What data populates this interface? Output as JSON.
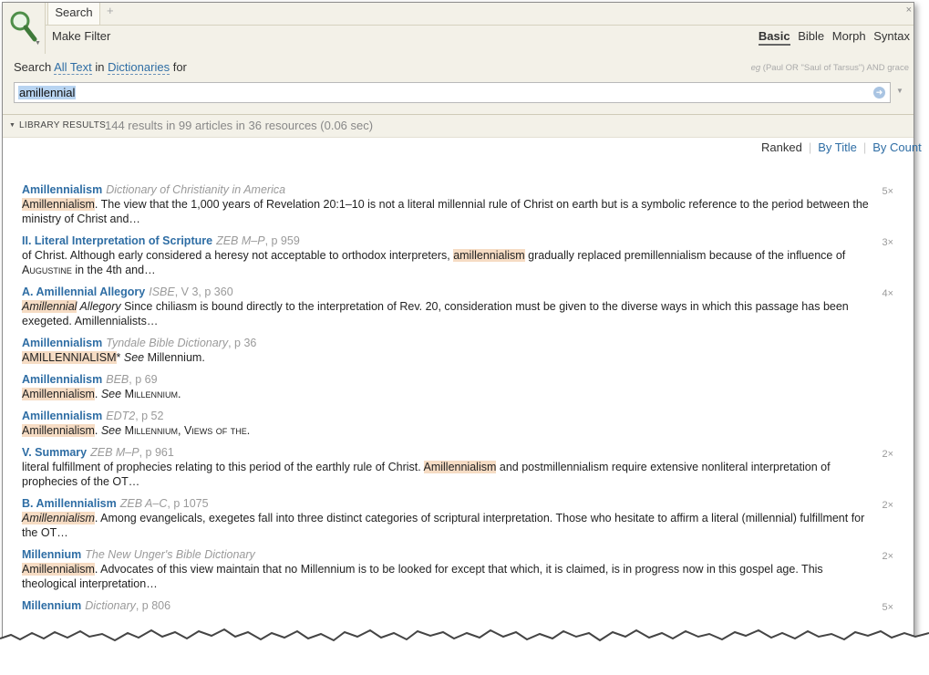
{
  "tabs": {
    "active": "Search",
    "add": "+",
    "close": "×"
  },
  "make_filter": "Make Filter",
  "modes": [
    "Basic",
    "Bible",
    "Morph",
    "Syntax"
  ],
  "search_line": {
    "prefix": "Search",
    "scope": "All Text",
    "in": "in",
    "collection": "Dictionaries",
    "for": "for"
  },
  "example": {
    "eg": "eg",
    "text": "(Paul OR \"Saul of Tarsus\") AND grace"
  },
  "query": "amillennial",
  "results_header": {
    "label": "LIBRARY RESULTS",
    "summary": "144 results in 99 articles in 36 resources (0.06 sec)"
  },
  "sort": {
    "ranked": "Ranked",
    "by_title": "By Title",
    "by_count": "By Count"
  },
  "results": [
    {
      "title": "Amillennialism",
      "source": "Dictionary of Christianity in America",
      "page": "",
      "count": "5×",
      "snippet": [
        [
          "Amillennialism",
          "hl"
        ],
        [
          ". The view that the 1,000 years of Revelation 20:1–10 is not a literal millennial rule of Christ on earth but is a symbolic reference to the period between the ministry of Christ and…",
          ""
        ]
      ]
    },
    {
      "title": "II. Literal Interpretation of Scripture",
      "source": "ZEB M–P",
      "page": ", p 959",
      "count": "3×",
      "snippet": [
        [
          "of Christ. Although early considered a heresy not acceptable to orthodox interpreters, ",
          ""
        ],
        [
          "amillennialism",
          "hl"
        ],
        [
          " gradually replaced premillennialism because of the influence of ",
          ""
        ],
        [
          "Augustine",
          "sc"
        ],
        [
          " in the 4th and…",
          ""
        ]
      ]
    },
    {
      "title": "A. Amillennial Allegory",
      "source": "ISBE",
      "page": ", V 3, p 360",
      "count": "4×",
      "snippet": [
        [
          "Amillennial",
          "hl-i"
        ],
        [
          " Allegory",
          "i"
        ],
        [
          " Since chiliasm is bound directly to the interpretation of Rev. 20, consideration must be given to the diverse ways in which this passage has been exegeted. Amillennialists…",
          ""
        ]
      ]
    },
    {
      "title": "Amillennialism",
      "source": "Tyndale Bible Dictionary",
      "page": ", p 36",
      "count": "",
      "snippet": [
        [
          "AMILLENNIALISM",
          "hl"
        ],
        [
          "* ",
          ""
        ],
        [
          "See",
          "i"
        ],
        [
          " Millennium.",
          ""
        ]
      ]
    },
    {
      "title": "Amillennialism",
      "source": "BEB",
      "page": ", p 69",
      "count": "",
      "snippet": [
        [
          "Amillennialism",
          "hl"
        ],
        [
          ". ",
          ""
        ],
        [
          "See",
          "i"
        ],
        [
          " ",
          ""
        ],
        [
          "Millennium.",
          "sc"
        ]
      ]
    },
    {
      "title": "Amillennialism",
      "source": "EDT2",
      "page": ", p 52",
      "count": "",
      "snippet": [
        [
          "Amillennialism",
          "hl"
        ],
        [
          ". ",
          ""
        ],
        [
          "See",
          "i"
        ],
        [
          " ",
          ""
        ],
        [
          "Millennium, Views of the.",
          "sc"
        ]
      ]
    },
    {
      "title": "V. Summary",
      "source": "ZEB M–P",
      "page": ", p 961",
      "count": "2×",
      "snippet": [
        [
          "literal fulfillment of prophecies relating to this period of the earthly rule of Christ. ",
          ""
        ],
        [
          "Amillennialism",
          "hl"
        ],
        [
          " and postmillennialism require extensive nonliteral interpretation of prophecies of the OT…",
          ""
        ]
      ]
    },
    {
      "title": "B. Amillennialism",
      "source": "ZEB A–C",
      "page": ", p 1075",
      "count": "2×",
      "snippet": [
        [
          "Amillennialism",
          "hl-i"
        ],
        [
          ". Among evangelicals, exegetes fall into three distinct categories of scriptural interpretation. Those who hesitate to affirm a literal (millennial) fulfillment for the OT…",
          ""
        ]
      ]
    },
    {
      "title": "Millennium",
      "source": "The New Unger's Bible Dictionary",
      "page": "",
      "count": "2×",
      "snippet": [
        [
          "Amillennialism",
          "hl"
        ],
        [
          ". Advocates of this view maintain that no Millennium is to be looked for except that which, it is claimed, is in progress now in this gospel age. This theological interpretation…",
          ""
        ]
      ]
    },
    {
      "title": "Millennium",
      "source": "Dictionary",
      "page": ", p 806",
      "count": "5×",
      "snippet": []
    }
  ]
}
